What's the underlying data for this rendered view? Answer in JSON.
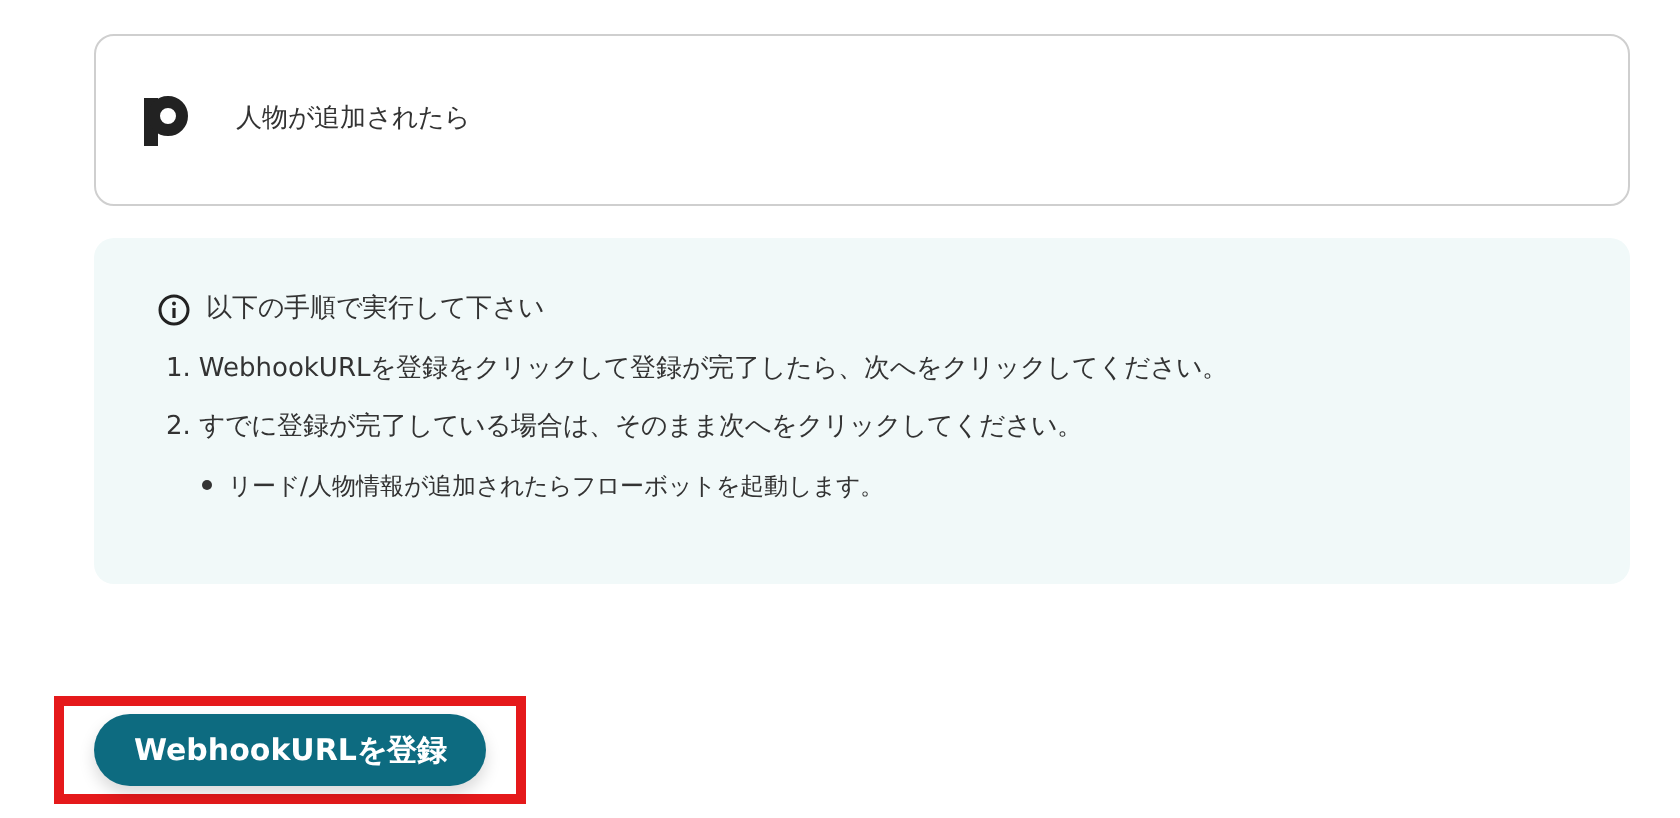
{
  "trigger": {
    "label": "人物が追加されたら"
  },
  "notice": {
    "title": "以下の手順で実行して下さい",
    "steps": [
      {
        "number": "1.",
        "text": "WebhookURLを登録をクリックして登録が完了したら、次へをクリックしてください。"
      },
      {
        "number": "2.",
        "text": "すでに登録が完了している場合は、そのまま次へをクリックしてください。"
      }
    ],
    "bullets": [
      "リード/人物情報が追加されたらフローボットを起動します。"
    ]
  },
  "button": {
    "label": "WebhookURLを登録",
    "highlighted": true
  }
}
